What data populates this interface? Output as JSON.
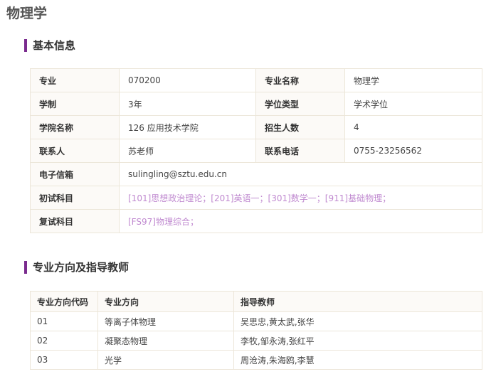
{
  "page_title": "物理学",
  "basic_info": {
    "heading": "基本信息",
    "rows": [
      {
        "l1": "专业",
        "v1": "070200",
        "l2": "专业名称",
        "v2": "物理学"
      },
      {
        "l1": "学制",
        "v1": "3年",
        "l2": "学位类型",
        "v2": "学术学位"
      },
      {
        "l1": "学院名称",
        "v1": "126 应用技术学院",
        "l2": "招生人数",
        "v2": "4"
      },
      {
        "l1": "联系人",
        "v1": "苏老师",
        "l2": "联系电话",
        "v2": "0755-23256562"
      }
    ],
    "email_label": "电子信箱",
    "email_value": "sulingling@sztu.edu.cn",
    "prelim_label": "初试科目",
    "prelim_value": "[101]思想政治理论；[201]英语一；[301]数学一；[911]基础物理；",
    "retest_label": "复试科目",
    "retest_value": "[FS97]物理综合；"
  },
  "directions": {
    "heading": "专业方向及指导教师",
    "headers": [
      "专业方向代码",
      "专业方向",
      "指导教师"
    ],
    "rows": [
      [
        "01",
        "等离子体物理",
        "吴思忠,黄太武,张华"
      ],
      [
        "02",
        "凝聚态物理",
        "李牧,邹永涛,张红平"
      ],
      [
        "03",
        "光学",
        "周沧涛,朱海鸥,李慧"
      ]
    ]
  },
  "colors": {
    "accent": "#7a2b8e",
    "link_purple": "#c08ad0",
    "border": "#ece6d9",
    "label_bg": "#fcfaf7"
  }
}
